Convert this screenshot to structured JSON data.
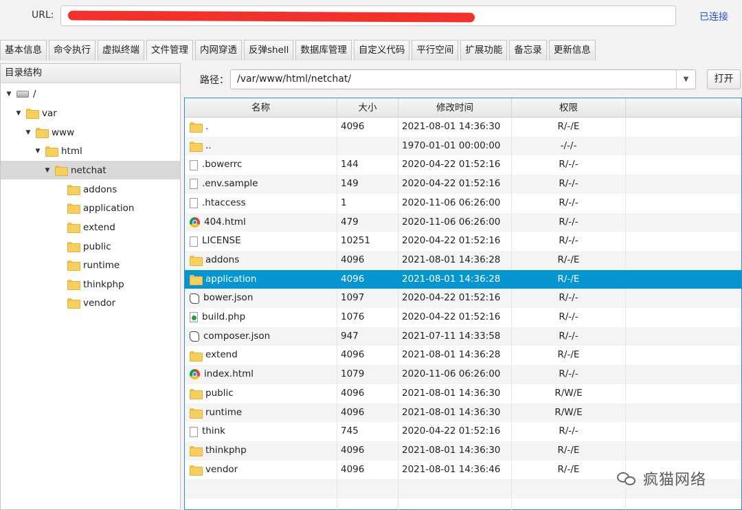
{
  "urlbar": {
    "label": "URL:",
    "status": "已连接"
  },
  "tabs": [
    "基本信息",
    "命令执行",
    "虚拟终端",
    "文件管理",
    "内网穿透",
    "反弹shell",
    "数据库管理",
    "自定义代码",
    "平行空间",
    "扩展功能",
    "备忘录",
    "更新信息"
  ],
  "active_tab": "文件管理",
  "tree": {
    "header": "目录结构",
    "items": [
      {
        "label": "/",
        "icon": "drive-icon",
        "expanded": true
      },
      {
        "label": "var",
        "icon": "folder-icon",
        "expanded": true
      },
      {
        "label": "www",
        "icon": "folder-icon",
        "expanded": true
      },
      {
        "label": "html",
        "icon": "folder-icon",
        "expanded": true
      },
      {
        "label": "netchat",
        "icon": "folder-icon",
        "expanded": true,
        "selected": true
      },
      {
        "label": "addons",
        "icon": "folder-icon"
      },
      {
        "label": "application",
        "icon": "folder-icon"
      },
      {
        "label": "extend",
        "icon": "folder-icon"
      },
      {
        "label": "public",
        "icon": "folder-icon"
      },
      {
        "label": "runtime",
        "icon": "folder-icon"
      },
      {
        "label": "thinkphp",
        "icon": "folder-icon"
      },
      {
        "label": "vendor",
        "icon": "folder-icon"
      }
    ]
  },
  "pathbar": {
    "label": "路径：",
    "value": "/var/www/html/netchat/",
    "open_label": "打开"
  },
  "table": {
    "headers": [
      "名称",
      "大小",
      "修改时间",
      "权限"
    ],
    "rows": [
      {
        "name": ".",
        "icon": "folder-icon",
        "size": "4096",
        "time": "2021-08-01 14:36:30",
        "perm": "R/-/E"
      },
      {
        "name": "..",
        "icon": "folder-icon",
        "size": "",
        "time": "1970-01-01 00:00:00",
        "perm": "-/-/-"
      },
      {
        "name": ".bowerrc",
        "icon": "file-icon",
        "size": "144",
        "time": "2020-04-22 01:52:16",
        "perm": "R/-/-"
      },
      {
        "name": ".env.sample",
        "icon": "file-icon",
        "size": "149",
        "time": "2020-04-22 01:52:16",
        "perm": "R/-/-"
      },
      {
        "name": ".htaccess",
        "icon": "file-icon",
        "size": "1",
        "time": "2020-11-06 06:26:00",
        "perm": "R/-/-"
      },
      {
        "name": "404.html",
        "icon": "chrome-icon",
        "size": "479",
        "time": "2020-11-06 06:26:00",
        "perm": "R/-/-"
      },
      {
        "name": "LICENSE",
        "icon": "file-icon",
        "size": "10251",
        "time": "2020-04-22 01:52:16",
        "perm": "R/-/-"
      },
      {
        "name": "addons",
        "icon": "folder-icon",
        "size": "4096",
        "time": "2021-08-01 14:36:28",
        "perm": "R/-/E"
      },
      {
        "name": "application",
        "icon": "folder-icon",
        "size": "4096",
        "time": "2021-08-01 14:36:28",
        "perm": "R/-/E",
        "selected": true
      },
      {
        "name": "bower.json",
        "icon": "script-icon",
        "size": "1097",
        "time": "2020-04-22 01:52:16",
        "perm": "R/-/-"
      },
      {
        "name": "build.php",
        "icon": "php-icon",
        "size": "1076",
        "time": "2020-04-22 01:52:16",
        "perm": "R/-/-"
      },
      {
        "name": "composer.json",
        "icon": "script-icon",
        "size": "947",
        "time": "2021-07-11 14:33:58",
        "perm": "R/-/-"
      },
      {
        "name": "extend",
        "icon": "folder-icon",
        "size": "4096",
        "time": "2021-08-01 14:36:28",
        "perm": "R/-/E"
      },
      {
        "name": "index.html",
        "icon": "chrome-icon",
        "size": "1079",
        "time": "2020-11-06 06:26:00",
        "perm": "R/-/-"
      },
      {
        "name": "public",
        "icon": "folder-icon",
        "size": "4096",
        "time": "2021-08-01 14:36:30",
        "perm": "R/W/E"
      },
      {
        "name": "runtime",
        "icon": "folder-icon",
        "size": "4096",
        "time": "2021-08-01 14:36:30",
        "perm": "R/W/E"
      },
      {
        "name": "think",
        "icon": "file-icon",
        "size": "745",
        "time": "2020-04-22 01:52:16",
        "perm": "R/-/-"
      },
      {
        "name": "thinkphp",
        "icon": "folder-icon",
        "size": "4096",
        "time": "2021-08-01 14:36:30",
        "perm": "R/-/E"
      },
      {
        "name": "vendor",
        "icon": "folder-icon",
        "size": "4096",
        "time": "2021-08-01 14:36:46",
        "perm": "R/-/E"
      }
    ]
  },
  "watermark": {
    "text": "疯猫网络",
    "icon": "wechat-icon"
  },
  "colors": {
    "selection": "#0596d1",
    "status_link": "#2a4fd6",
    "redaction": "#f2312a",
    "folder": "#f6cf5d"
  }
}
